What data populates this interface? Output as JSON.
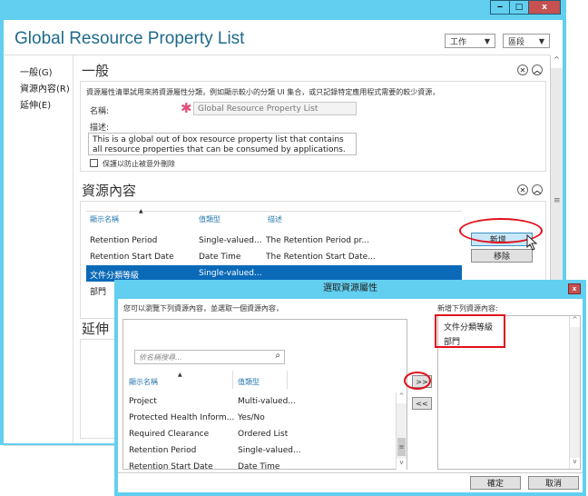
{
  "window": {
    "title": "Global Resource Property List",
    "controls": {
      "minimize": "‒",
      "maximize": "□",
      "close": "x"
    },
    "dropdowns": [
      {
        "label": "工作",
        "arrow": "▼"
      },
      {
        "label": "區段",
        "arrow": "▼"
      }
    ]
  },
  "nav": {
    "items": [
      {
        "label": "一般(G)"
      },
      {
        "label": "資源內容(R)"
      },
      {
        "label": "延伸(E)"
      }
    ]
  },
  "general": {
    "title": "一般",
    "description_text": "資源屬性清單試用來將資源屬性分類，例如顯示較小的分類 UI 集合，或只記錄特定應用程式需要的較少資源，",
    "name_label": "名稱:",
    "name_required": "✱",
    "name_value": "Global Resource Property List",
    "desc_label": "描述:",
    "desc_value": "This is a global out of box resource property list that contains all resource properties that can be consumed by applications.",
    "protect_label": "保護以防止被意外刪除",
    "protect_checked": false
  },
  "section_buttons": {
    "close": "✕",
    "collapse": "︿"
  },
  "resources": {
    "title": "資源內容",
    "columns": [
      "顯示名稱",
      "值類型",
      "描述"
    ],
    "sort_indicator": "▲",
    "rows": [
      {
        "name": "Retention Period",
        "type": "Single-valued...",
        "desc": "The Retention Period pr...",
        "selected": false
      },
      {
        "name": "Retention Start Date",
        "type": "Date Time",
        "desc": "The Retention Start Date...",
        "selected": false
      },
      {
        "name": "文件分類等級",
        "type": "Single-valued...",
        "desc": "",
        "selected": true
      },
      {
        "name": "部門",
        "type": "",
        "desc": "",
        "selected": false
      }
    ],
    "add_button": "新增...",
    "remove_button": "移除"
  },
  "extensions": {
    "title": "延伸"
  },
  "dialog": {
    "title": "選取資源屬性",
    "close": "x",
    "instruction": "您可以瀏覽下列資源內容，並選取一個資源內容，",
    "search_placeholder": "依名稱搜尋...",
    "search_icon": "⌕",
    "columns": [
      "顯示名稱",
      "值類型"
    ],
    "sort_indicator": "▲",
    "rows": [
      {
        "name": "Project",
        "type": "Multi-valued..."
      },
      {
        "name": "Protected Health Inform...",
        "type": "Yes/No"
      },
      {
        "name": "Required Clearance",
        "type": "Ordered List"
      },
      {
        "name": "Retention Period",
        "type": "Single-valued..."
      },
      {
        "name": "Retention Start Date",
        "type": "Date Time"
      }
    ],
    "add_arrow": ">>",
    "remove_arrow": "<<",
    "selected_label": "新增下列資源內容:",
    "selected_items": [
      "文件分類等級",
      "部門"
    ],
    "ok": "確定",
    "cancel": "取消"
  }
}
